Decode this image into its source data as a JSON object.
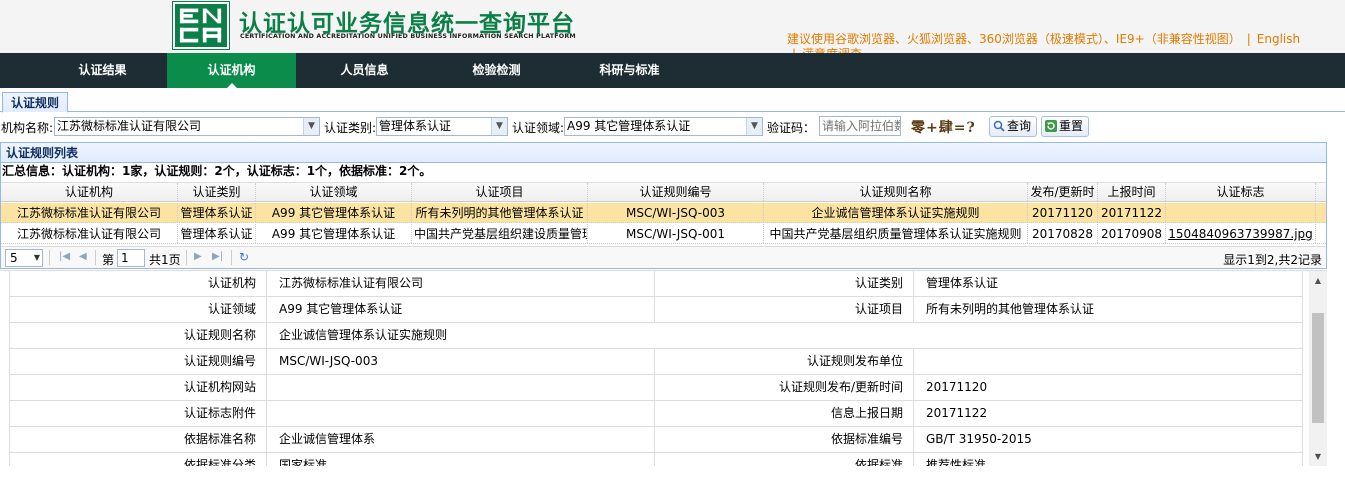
{
  "header": {
    "logo_letters": "EN CA",
    "title_cn": "认证认可业务信息统一查询平台",
    "title_en": "CERTIFICATION AND ACCREDITATION UNIFIED BUSINESS INFORMATION SEARCH PLATFORM",
    "browser_notice": "建议使用谷歌浏览器、火狐浏览器、360浏览器（极速模式）、IE9+（非兼容性视图）",
    "english_link": "English",
    "survey_link": "满意度调查",
    "separator": "|",
    "brand_color": "#0b7f47",
    "notice_color": "#e07b00"
  },
  "nav": {
    "items": [
      {
        "label": "认证结果"
      },
      {
        "label": "认证机构"
      },
      {
        "label": "人员信息"
      },
      {
        "label": "检验检测"
      },
      {
        "label": "科研与标准"
      }
    ],
    "active_index": 1,
    "bg_color": "#1e2d33",
    "active_color": "#0b8c4a"
  },
  "tabs": {
    "rules_tab": "认证规则"
  },
  "search": {
    "org_label": "机构名称:",
    "org_value": "江苏微标标准认证有限公司",
    "category_label": "认证类别:",
    "category_value": "管理体系认证",
    "domain_label": "认证领域:",
    "domain_value": "A99 其它管理体系认证",
    "captcha_label": "验证码：",
    "captcha_placeholder": "请输入阿拉伯数",
    "captcha_text": "零+肆=?",
    "query_button": "查询",
    "reset_button": "重置"
  },
  "grid": {
    "title": "认证规则列表",
    "summary": "汇总信息：认证机构：1家，认证规则：2个，认证标志：1个，依据标准：2个。",
    "columns": [
      "认证机构",
      "认证类别",
      "认证领域",
      "认证项目",
      "认证规则编号",
      "认证规则名称",
      "发布/更新时",
      "上报时间",
      "认证标志"
    ],
    "rows": [
      [
        "江苏微标标准认证有限公司",
        "管理体系认证",
        "A99 其它管理体系认证",
        "所有未列明的其他管理体系认证",
        "MSC/WI-JSQ-003",
        "企业诚信管理体系认证实施规则",
        "20171120",
        "20171122",
        ""
      ],
      [
        "江苏微标标准认证有限公司",
        "管理体系认证",
        "A99 其它管理体系认证",
        "中国共产党基层组织建设质量管理",
        "MSC/WI-JSQ-001",
        "中国共产党基层组织质量管理体系认证实施规则",
        "20170828",
        "20170908",
        "1504840963739987.jpg"
      ]
    ],
    "selected_row": 0,
    "selected_color": "#fbe4a1"
  },
  "pager": {
    "page_size": "5",
    "page_prefix": "第",
    "page_number": "1",
    "page_suffix": "共1页",
    "info": "显示1到2,共2记录"
  },
  "detail": {
    "rows": [
      {
        "l1": "认证机构",
        "v1": "江苏微标标准认证有限公司",
        "l2": "认证类别",
        "v2": "管理体系认证"
      },
      {
        "l1": "认证领域",
        "v1": "A99 其它管理体系认证",
        "l2": "认证项目",
        "v2": "所有未列明的其他管理体系认证"
      },
      {
        "l1": "认证规则名称",
        "v1": "企业诚信管理体系认证实施规则"
      },
      {
        "l1": "认证规则编号",
        "v1": "MSC/WI-JSQ-003",
        "l2": "认证规则发布单位",
        "v2": ""
      },
      {
        "l1": "认证机构网站",
        "v1": "",
        "l2": "认证规则发布/更新时间",
        "v2": "20171120"
      },
      {
        "l1": "认证标志附件",
        "v1": "",
        "l2": "信息上报日期",
        "v2": "20171122"
      },
      {
        "l1": "依据标准名称",
        "v1": "企业诚信管理体系",
        "l2": "依据标准编号",
        "v2": "GB/T 31950-2015"
      },
      {
        "l1": "依据标准分类",
        "v1": "国家标准",
        "l2": "依据标准",
        "v2": "推荐性标准"
      }
    ]
  }
}
